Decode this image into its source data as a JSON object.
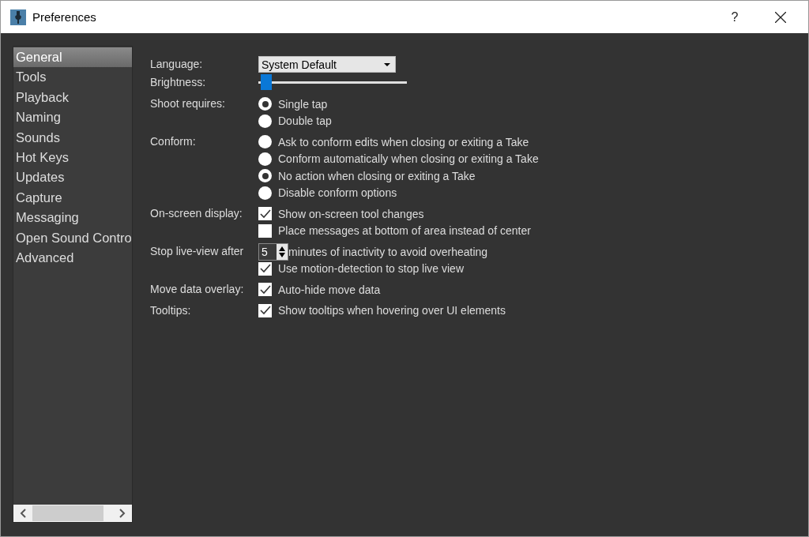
{
  "window": {
    "title": "Preferences",
    "help": "?"
  },
  "sidebar": {
    "items": [
      {
        "label": "General",
        "selected": true
      },
      {
        "label": "Tools",
        "selected": false
      },
      {
        "label": "Playback",
        "selected": false
      },
      {
        "label": "Naming",
        "selected": false
      },
      {
        "label": "Sounds",
        "selected": false
      },
      {
        "label": "Hot Keys",
        "selected": false
      },
      {
        "label": "Updates",
        "selected": false
      },
      {
        "label": "Capture",
        "selected": false
      },
      {
        "label": "Messaging",
        "selected": false
      },
      {
        "label": "Open Sound Contro",
        "selected": false
      },
      {
        "label": "Advanced",
        "selected": false
      }
    ]
  },
  "settings": [
    {
      "label": "Language:",
      "kind": "dropdown",
      "value": "System Default"
    },
    {
      "label": "Brightness:",
      "kind": "slider",
      "level": 0.02
    },
    {
      "label": "Shoot requires:",
      "kind": "radio",
      "options": [
        {
          "label": "Single tap",
          "selected": true
        },
        {
          "label": "Double tap",
          "selected": false
        }
      ]
    },
    {
      "label": "Conform:",
      "kind": "radio",
      "options": [
        {
          "label": "Ask to conform edits when closing or exiting a Take",
          "selected": false
        },
        {
          "label": "Conform automatically when closing or exiting a Take",
          "selected": false
        },
        {
          "label": "No action when closing or exiting a Take",
          "selected": true
        },
        {
          "label": "Disable conform options",
          "selected": false
        }
      ]
    },
    {
      "label": "On-screen display:",
      "kind": "checkbox",
      "options": [
        {
          "label": "Show on-screen tool changes",
          "checked": true
        },
        {
          "label": "Place messages at bottom of area instead of center",
          "checked": false
        }
      ]
    },
    {
      "label": "Stop live-view after",
      "kind": "spin",
      "value": "5",
      "suffix": "minutes of inactivity to avoid overheating",
      "options": [
        {
          "label": "Use motion-detection to stop live view",
          "checked": true
        }
      ]
    },
    {
      "label": "Move data overlay:",
      "kind": "checkbox",
      "options": [
        {
          "label": "Auto-hide move data",
          "checked": true
        }
      ]
    },
    {
      "label": "Tooltips:",
      "kind": "checkbox",
      "options": [
        {
          "label": "Show tooltips when hovering over UI elements",
          "checked": true
        }
      ]
    }
  ]
}
